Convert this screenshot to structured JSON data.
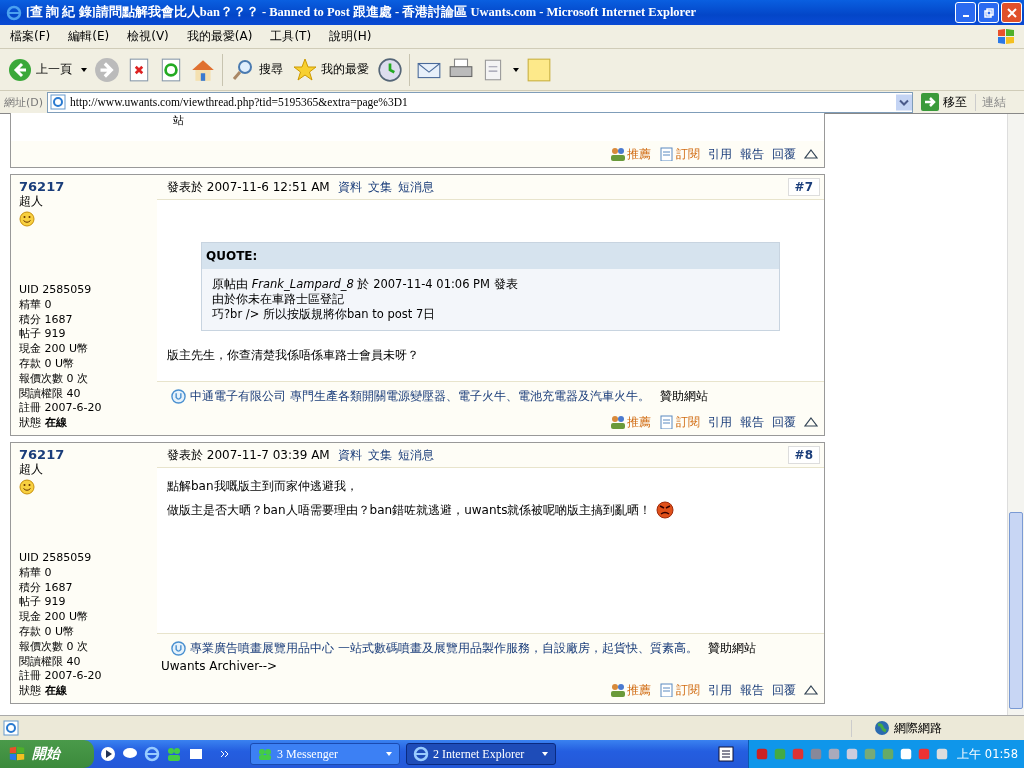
{
  "window": {
    "title": "[查 詢 紀 錄]請問點解我會比人ban？？？ - Banned to Post 跟進處 - 香港討論區 Uwants.com - Microsoft Internet Explorer"
  },
  "menu": [
    "檔案(F)",
    "編輯(E)",
    "檢視(V)",
    "我的最愛(A)",
    "工具(T)",
    "說明(H)"
  ],
  "toolbar": {
    "back": "上一頁",
    "search": "搜尋",
    "favorites": "我的最愛"
  },
  "address": {
    "label": "網址(D)",
    "url": "http://www.uwants.com/viewthread.php?tid=5195365&extra=page%3D1",
    "go": "移至",
    "links": "連結"
  },
  "top_fragment": {
    "text": "站",
    "actions": [
      {
        "label": "推薦",
        "kind": "featured"
      },
      {
        "label": "訂閱",
        "kind": "featured"
      },
      {
        "label": "引用",
        "kind": "plain"
      },
      {
        "label": "報告",
        "kind": "plain"
      },
      {
        "label": "回覆",
        "kind": "plain"
      }
    ]
  },
  "posts": [
    {
      "author": "76217",
      "rank": "超人",
      "stats": [
        "UID 2585059",
        "精華 0",
        "積分 1687",
        "帖子 919",
        "現金 200 U幣",
        "存款 0 U幣",
        "報價次數 0 次",
        "閱讀權限 40",
        "註冊 2007-6-20"
      ],
      "status": "狀態 **在線**",
      "posted": "發表於 2007-11-6 12:51 AM",
      "links": [
        "資料",
        "文集",
        "短消息"
      ],
      "number": "#7",
      "quote": {
        "title": "QUOTE:",
        "lines": [
          "原帖由 *Frank_Lampard_8* 於 2007-11-4 01:06 PM 發表",
          "由於你未在車路士區登記",
          "巧?br /> 所以按版規將你ban to post 7日"
        ]
      },
      "body": [
        {
          "text": "版主先生，你查清楚我係唔係車路士會員未呀？",
          "has_emoticon": false
        }
      ],
      "ad": {
        "text": "中通電子有限公司 專門生產各類開關電源變壓器、電子火牛、電池充電器及汽車火牛。",
        "sponsor": "贊助網站"
      },
      "actions": [
        {
          "label": "推薦",
          "kind": "featured"
        },
        {
          "label": "訂閱",
          "kind": "featured"
        },
        {
          "label": "引用",
          "kind": "plain"
        },
        {
          "label": "報告",
          "kind": "plain"
        },
        {
          "label": "回覆",
          "kind": "plain"
        }
      ]
    },
    {
      "author": "76217",
      "rank": "超人",
      "stats": [
        "UID 2585059",
        "精華 0",
        "積分 1687",
        "帖子 919",
        "現金 200 U幣",
        "存款 0 U幣",
        "報價次數 0 次",
        "閱讀權限 40",
        "註冊 2007-6-20"
      ],
      "status": "狀態 **在線**",
      "posted": "發表於 2007-11-7 03:39 AM",
      "links": [
        "資料",
        "文集",
        "短消息"
      ],
      "number": "#8",
      "body": [
        {
          "text": "點解ban我嘅版主到而家仲逃避我，",
          "has_emoticon": false
        },
        {
          "text": "做版主是否大晒？ban人唔需要理由？ban錯咗就逃避，uwants就係被呢啲版主搞到亂晒！",
          "has_emoticon": true
        }
      ],
      "ad": {
        "text": "專業廣告噴畫展覽用品中心 一站式數碼噴畫及展覽用品製作服務，自設廠房，起貨快、質素高。",
        "sponsor": "贊助網站"
      },
      "footer_note": "Uwants Archiver-->",
      "actions": [
        {
          "label": "推薦",
          "kind": "featured"
        },
        {
          "label": "訂閱",
          "kind": "featured"
        },
        {
          "label": "引用",
          "kind": "plain"
        },
        {
          "label": "報告",
          "kind": "plain"
        },
        {
          "label": "回覆",
          "kind": "plain"
        }
      ]
    }
  ],
  "status_bar": {
    "zone": "網際網路"
  },
  "taskbar": {
    "start": "開始",
    "tasks": [
      {
        "label": "3 Messenger",
        "selected": false
      },
      {
        "label": "2 Internet Explorer",
        "selected": true
      }
    ],
    "clock": "上午 01:58"
  }
}
